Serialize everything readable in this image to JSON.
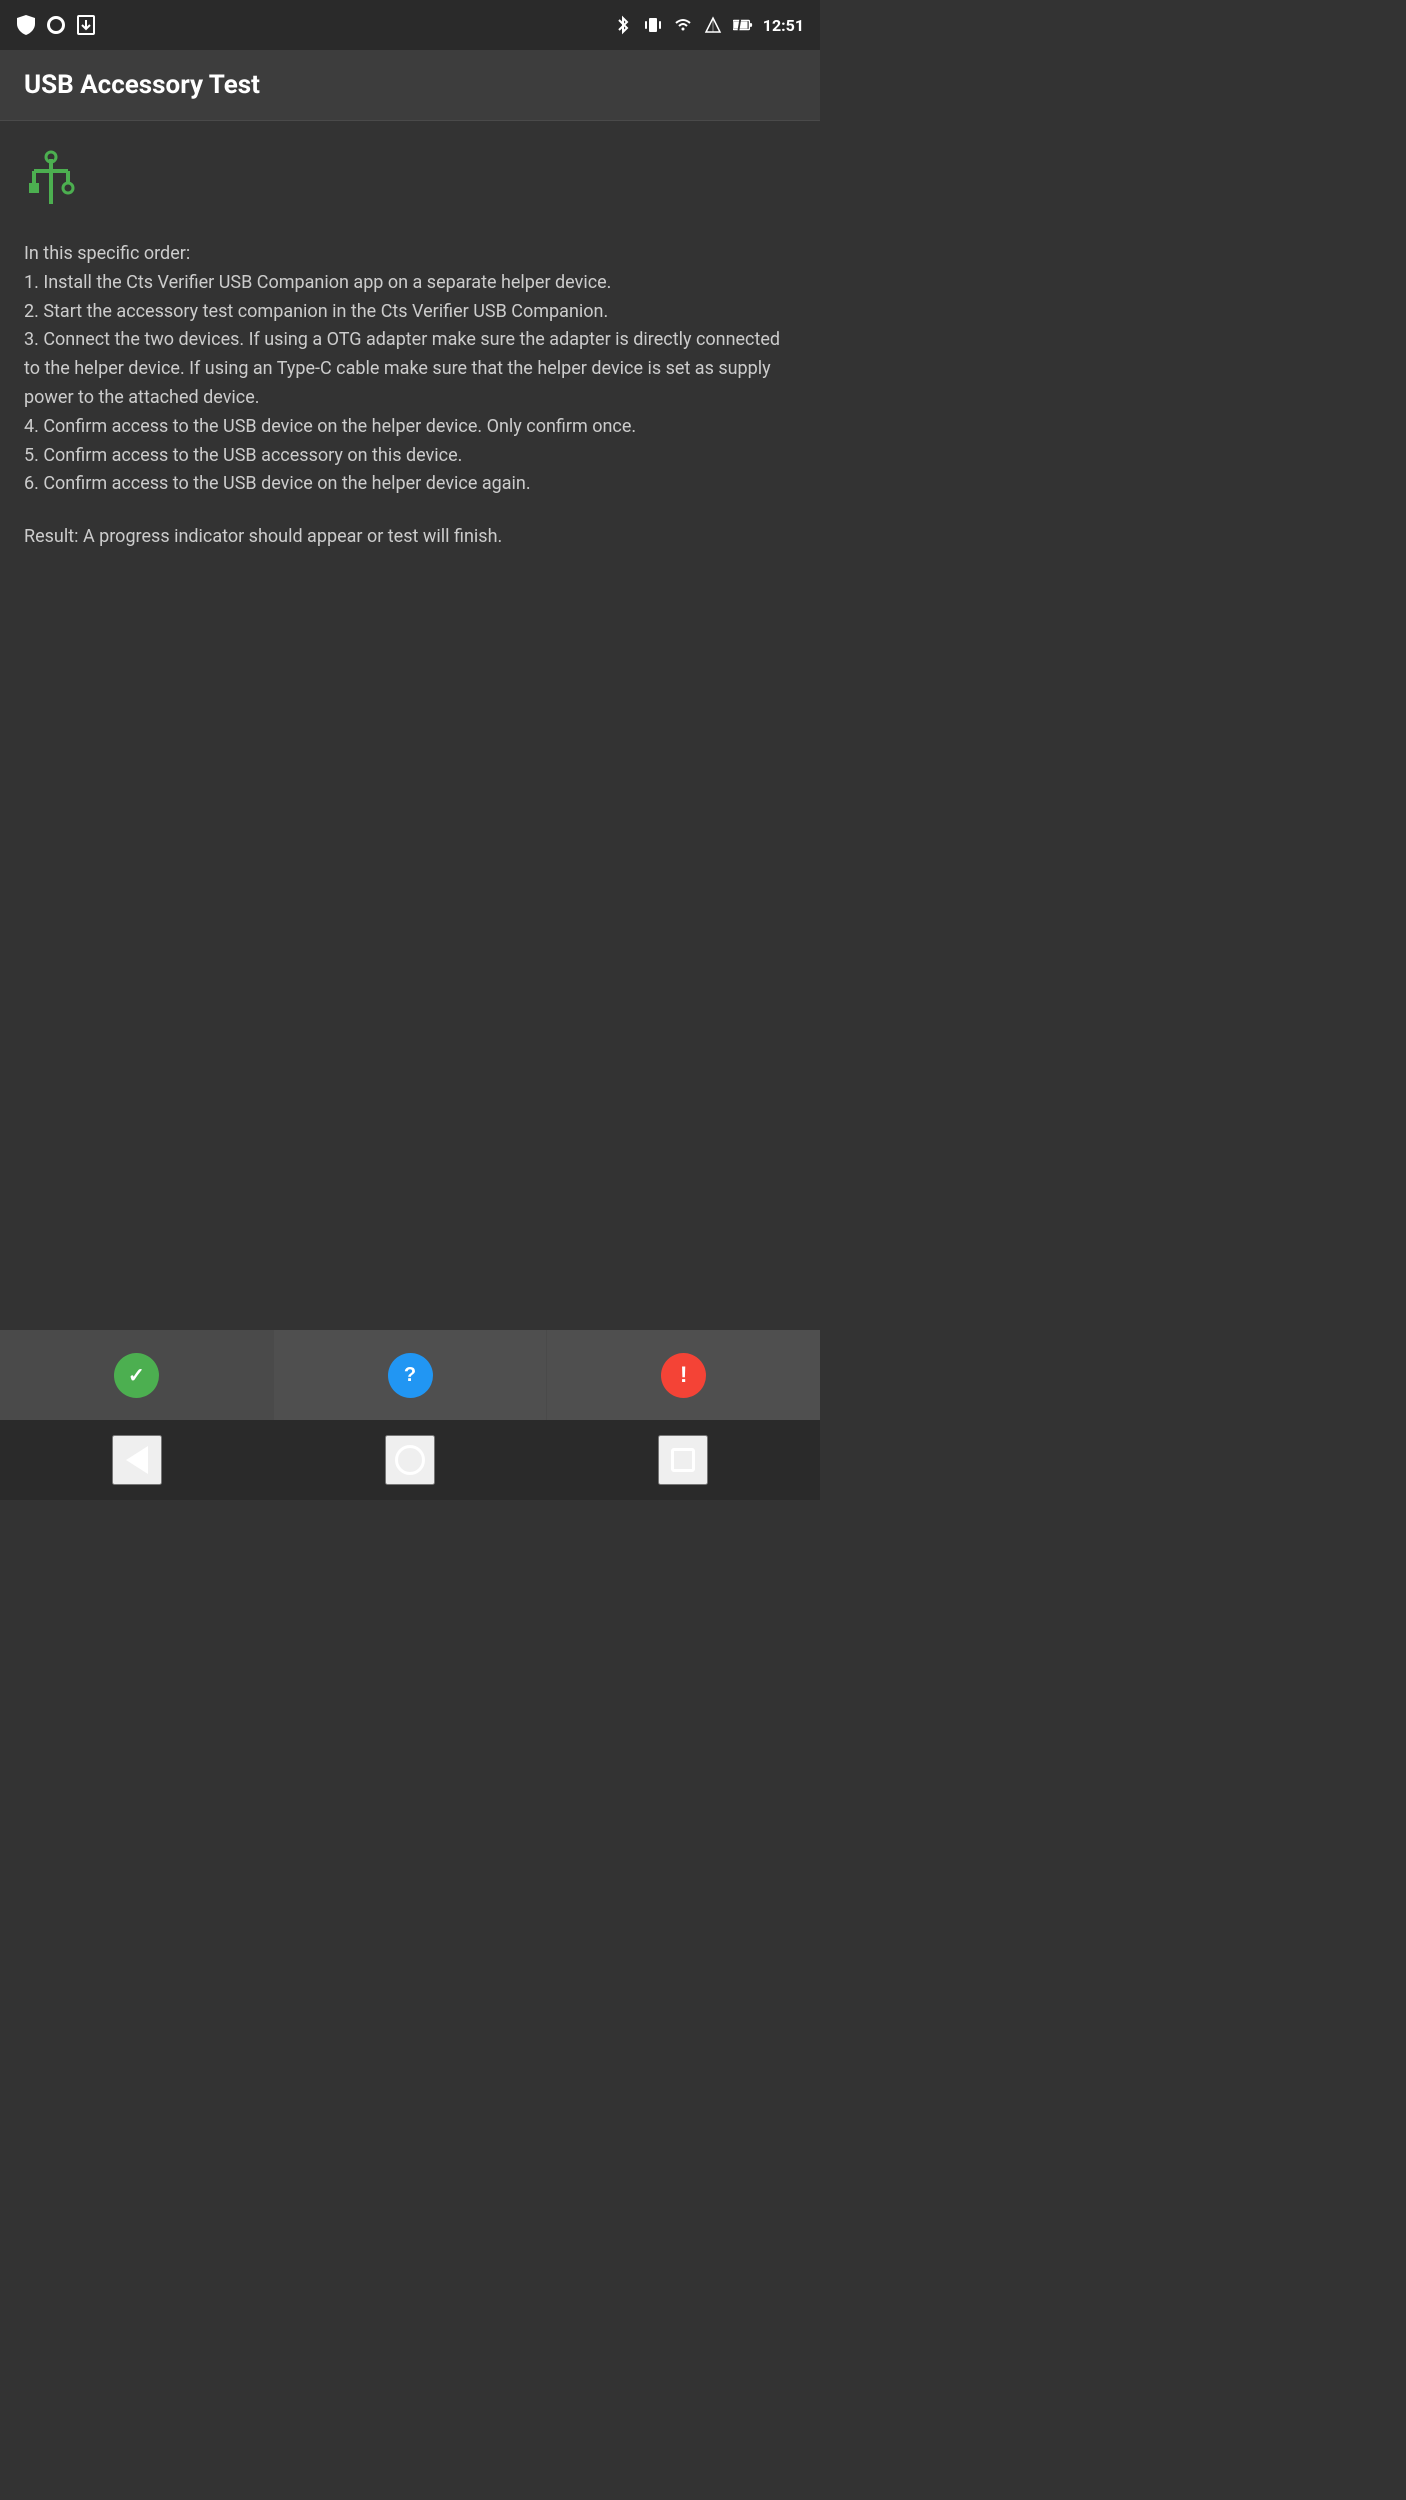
{
  "statusBar": {
    "time": "12:51"
  },
  "header": {
    "title": "USB Accessory Test"
  },
  "content": {
    "usbIconLabel": "USB symbol",
    "instructions": "In this specific order:\n1. Install the Cts Verifier USB Companion app on a separate helper device.\n2. Start the accessory test companion in the Cts Verifier USB Companion.\n3. Connect the two devices. If using a OTG adapter make sure the adapter is directly connected to the helper device. If using an Type-C cable make sure that the helper device is set as supply power to the attached device.\n4. Confirm access to the USB device on the helper device. Only confirm once.\n5. Confirm access to the USB accessory on this device.\n6. Confirm access to the USB device on the helper device again.",
    "result": "Result: A progress indicator should appear or test will finish."
  },
  "bottomBar": {
    "passLabel": "pass",
    "infoLabel": "info",
    "failLabel": "fail",
    "passIcon": "✓",
    "infoIcon": "?",
    "failIcon": "!"
  },
  "navBar": {
    "backLabel": "back",
    "homeLabel": "home",
    "recentLabel": "recent"
  }
}
